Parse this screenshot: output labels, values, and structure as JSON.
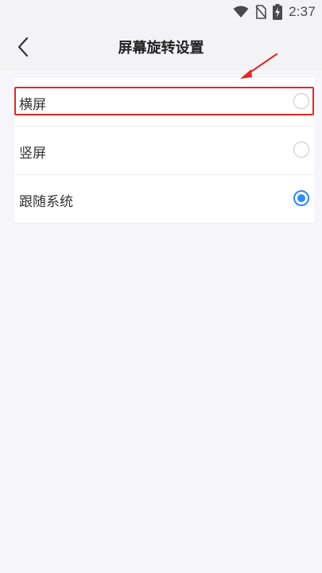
{
  "status_bar": {
    "time": "2:37",
    "icons": [
      "wifi-icon",
      "no-sim-icon",
      "battery-charging-icon"
    ]
  },
  "header": {
    "title": "屏幕旋转设置",
    "back_icon": "chevron-left-icon"
  },
  "options": [
    {
      "label": "横屏",
      "selected": false
    },
    {
      "label": "竖屏",
      "selected": false
    },
    {
      "label": "跟随系统",
      "selected": true
    }
  ],
  "annotation": {
    "highlight_color": "#e32a2a",
    "accent_color": "#2e8cf0"
  }
}
